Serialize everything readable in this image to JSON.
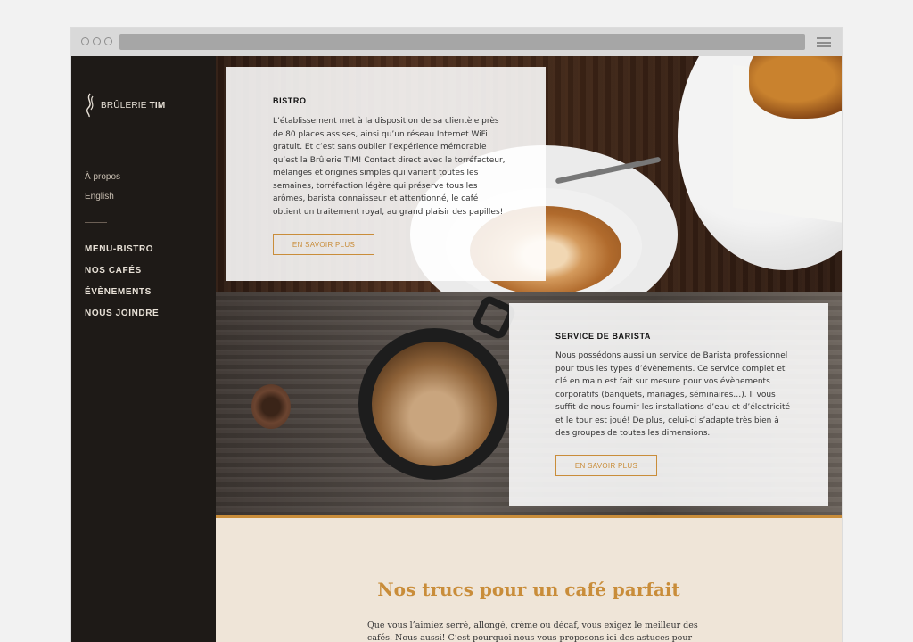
{
  "brand": {
    "name_light": "BRÛLERIE",
    "name_bold": "TIM"
  },
  "lang_links": [
    "À propos",
    "English"
  ],
  "nav": [
    "MENU-BISTRO",
    "NOS CAFÉS",
    "ÉVÈNEMENTS",
    "NOUS JOINDRE"
  ],
  "cards": [
    {
      "title": "BISTRO",
      "body": "L’établissement met à la disposition de sa clientèle près de 80 places assises, ainsi qu’un réseau Internet WiFi gratuit. Et c’est sans oublier l’expérience mémorable qu’est la Brûlerie TIM! Contact direct avec le torréfacteur, mélanges et origines simples qui varient toutes les semaines, torréfaction légère qui préserve tous les arômes, barista connaisseur et attentionné, le café obtient un traitement royal, au grand plaisir des papilles!",
      "button": "EN SAVOIR PLUS"
    },
    {
      "title": "SERVICE DE BARISTA",
      "body": "Nous possédons aussi un service de Barista professionnel pour tous les types d’évènements. Ce service complet et clé en main est fait sur mesure pour vos évènements corporatifs (banquets, mariages, séminaires…). Il vous suffit de nous fournir les installations d’eau et d’électricité et le tour est joué! De plus, celui-ci s’adapte très bien à des groupes de toutes les dimensions.",
      "button": "EN SAVOIR PLUS"
    }
  ],
  "tips": {
    "title": "Nos trucs pour un café parfait",
    "text": "Que vous l’aimiez serré, allongé, crème ou décaf, vous exigez le meilleur des cafés. Nous aussi! C’est pourquoi nous vous proposons ici des astuces pour savourer tous"
  },
  "colors": {
    "accent": "#c98d3a",
    "sidebar": "#1e1a17",
    "tips_bg": "#efe5d8"
  }
}
